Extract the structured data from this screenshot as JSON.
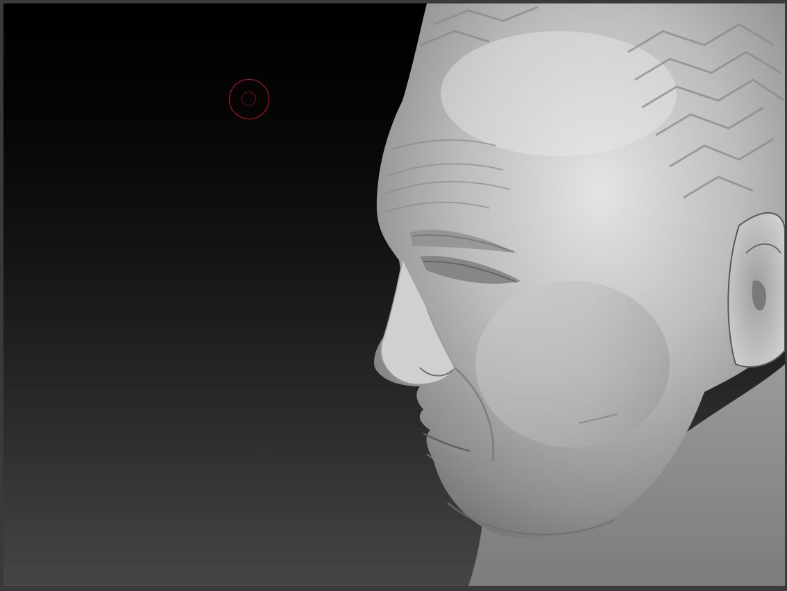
{
  "app": {
    "frame_color": "#3a3a3a"
  },
  "viewport": {
    "background_top": "#000000",
    "background_bottom": "#454545",
    "model": {
      "icon": "sculpted-head-model",
      "material_color": "#b9b9b9"
    },
    "brush_cursor": {
      "icon": "brush-circle-cursor",
      "color": "#c4161c"
    }
  }
}
